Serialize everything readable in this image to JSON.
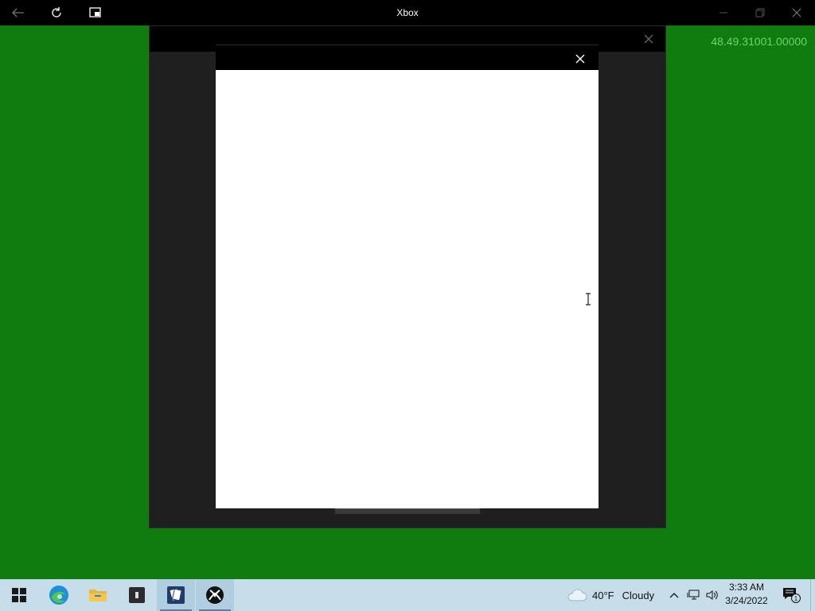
{
  "window": {
    "title": "Xbox",
    "version": "48.49.31001.00000"
  },
  "titlebar": {
    "back_icon": "back-arrow-icon",
    "refresh_icon": "refresh-icon",
    "compact_icon": "compact-overlay-icon",
    "minimize_icon": "minimize-icon",
    "restore_icon": "restore-icon",
    "close_icon": "close-icon"
  },
  "taskbar": {
    "apps": [
      {
        "name": "Start",
        "icon": "windows-logo-icon"
      },
      {
        "name": "Microsoft Edge",
        "icon": "edge-icon"
      },
      {
        "name": "File Explorer",
        "icon": "folder-icon"
      },
      {
        "name": "App",
        "icon": "app-icon"
      },
      {
        "name": "Solitaire",
        "icon": "cards-icon"
      },
      {
        "name": "Xbox",
        "icon": "xbox-icon"
      }
    ],
    "weather": {
      "temp": "40°F",
      "condition": "Cloudy"
    },
    "clock": {
      "time": "3:33 AM",
      "date": "3/24/2022"
    },
    "notification_count": "1"
  },
  "colors": {
    "desktop": "#107c10",
    "titlebar": "#000000",
    "dialog": "#1f1f1f",
    "taskbar": "#c7ddea",
    "version_text": "#6fd36f"
  }
}
